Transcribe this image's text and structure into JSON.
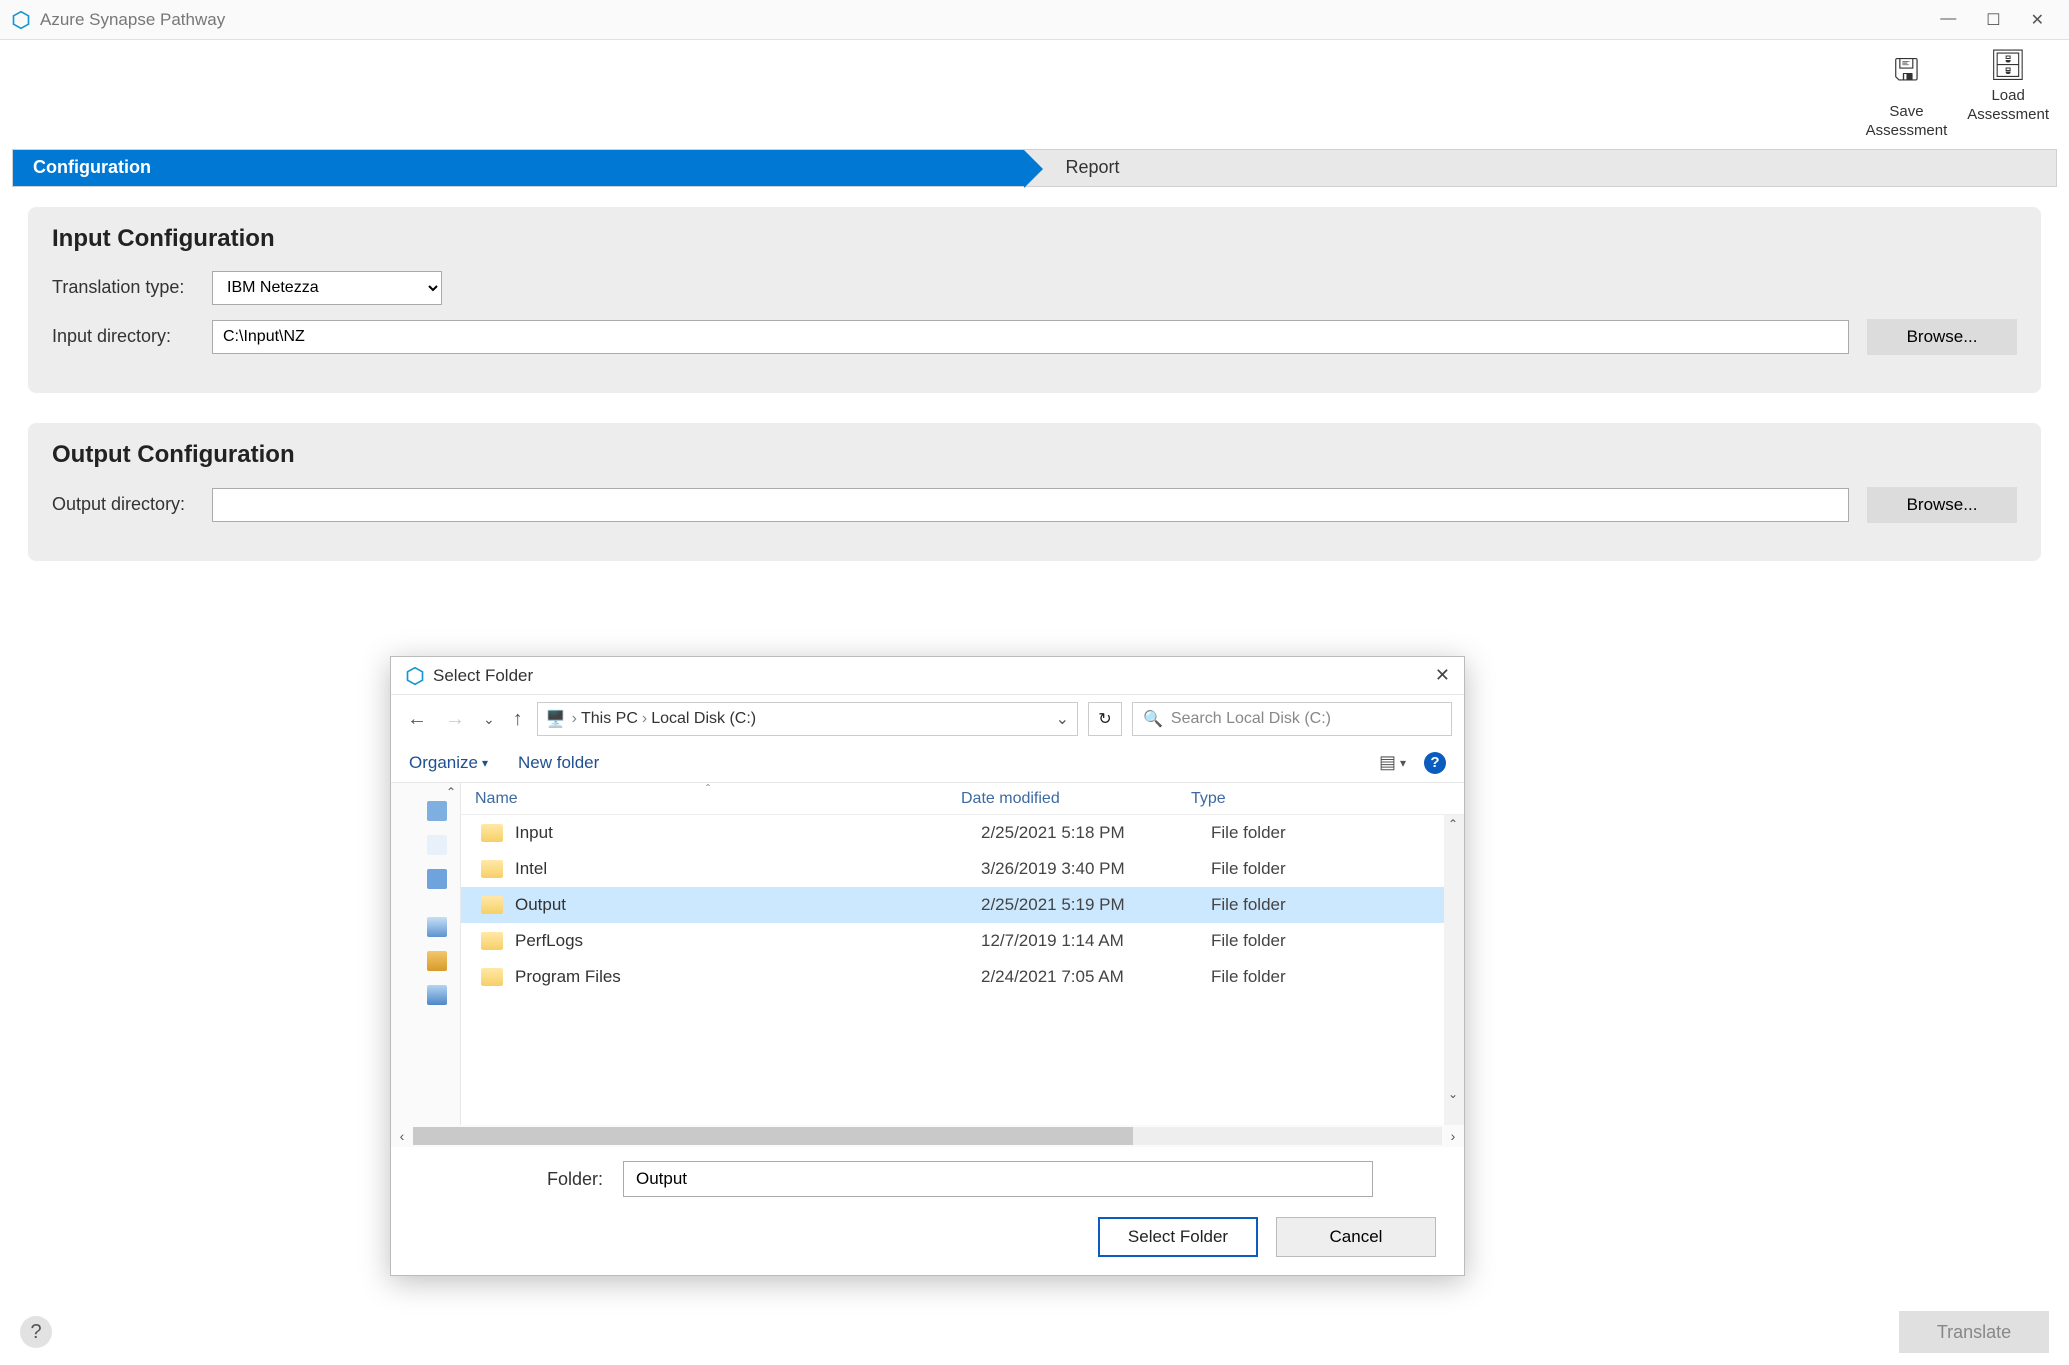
{
  "app": {
    "title": "Azure Synapse Pathway"
  },
  "toolbar": {
    "save_label": "Save\nAssessment",
    "load_label": "Load\nAssessment"
  },
  "tabs": {
    "configuration": "Configuration",
    "report": "Report"
  },
  "input_config": {
    "heading": "Input Configuration",
    "translation_type_label": "Translation type:",
    "translation_type_value": "IBM Netezza",
    "input_directory_label": "Input directory:",
    "input_directory_value": "C:\\Input\\NZ",
    "browse": "Browse..."
  },
  "output_config": {
    "heading": "Output Configuration",
    "output_directory_label": "Output directory:",
    "output_directory_value": "",
    "browse": "Browse..."
  },
  "footer": {
    "translate": "Translate"
  },
  "dialog": {
    "title": "Select Folder",
    "breadcrumb": {
      "pc": "This PC",
      "drive": "Local Disk (C:)"
    },
    "search_placeholder": "Search Local Disk (C:)",
    "organize": "Organize",
    "new_folder": "New folder",
    "columns": {
      "name": "Name",
      "date": "Date modified",
      "type": "Type"
    },
    "rows": [
      {
        "name": "Input",
        "date": "2/25/2021 5:18 PM",
        "type": "File folder",
        "selected": false
      },
      {
        "name": "Intel",
        "date": "3/26/2019 3:40 PM",
        "type": "File folder",
        "selected": false
      },
      {
        "name": "Output",
        "date": "2/25/2021 5:19 PM",
        "type": "File folder",
        "selected": true
      },
      {
        "name": "PerfLogs",
        "date": "12/7/2019 1:14 AM",
        "type": "File folder",
        "selected": false
      },
      {
        "name": "Program Files",
        "date": "2/24/2021 7:05 AM",
        "type": "File folder",
        "selected": false
      }
    ],
    "folder_label": "Folder:",
    "folder_value": "Output",
    "select_button": "Select Folder",
    "cancel_button": "Cancel"
  }
}
